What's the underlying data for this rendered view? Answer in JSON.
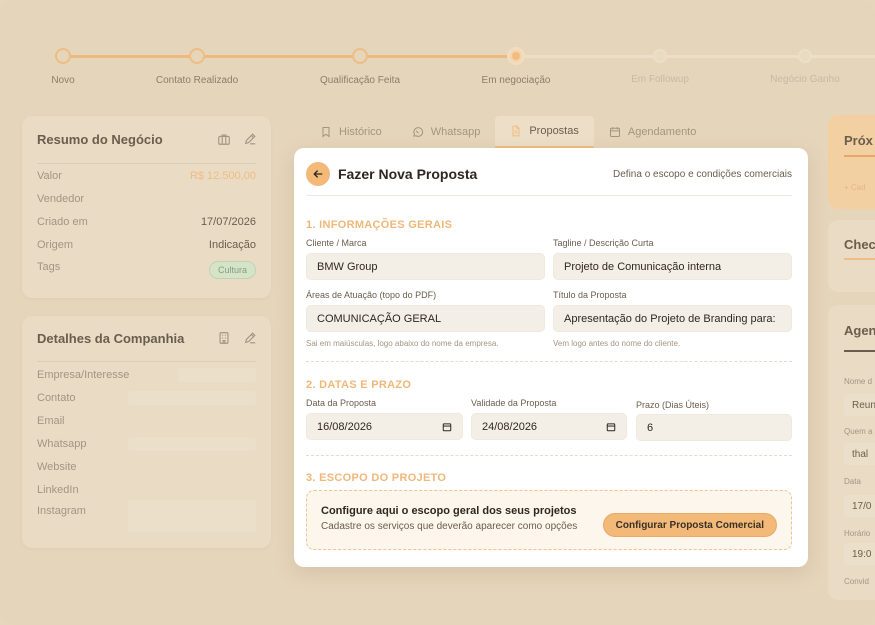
{
  "pipeline": {
    "stages": [
      {
        "label": "Novo"
      },
      {
        "label": "Contato Realizado"
      },
      {
        "label": "Qualificação Feita"
      },
      {
        "label": "Em negociação"
      },
      {
        "label": "Em Followup"
      },
      {
        "label": "Negócio Ganho"
      }
    ]
  },
  "deal_summary": {
    "title": "Resumo do Negócio",
    "rows": [
      {
        "label": "Valor",
        "value": "R$ 12.500,00"
      },
      {
        "label": "Vendedor",
        "value": ""
      },
      {
        "label": "Criado em",
        "value": "17/07/2026"
      },
      {
        "label": "Origem",
        "value": "Indicação"
      },
      {
        "label": "Tags",
        "value": "Cultura"
      }
    ]
  },
  "company_details": {
    "title": "Detalhes da Companhia",
    "rows": [
      {
        "label": "Empresa/Interesse"
      },
      {
        "label": "Contato"
      },
      {
        "label": "Email"
      },
      {
        "label": "Whatsapp"
      },
      {
        "label": "Website"
      },
      {
        "label": "LinkedIn"
      },
      {
        "label": "Instagram"
      }
    ]
  },
  "tabs": [
    {
      "label": "Histórico",
      "icon": "bookmark-icon"
    },
    {
      "label": "Whatsapp",
      "icon": "whatsapp-icon"
    },
    {
      "label": "Propostas",
      "icon": "document-icon"
    },
    {
      "label": "Agendamento",
      "icon": "calendar-icon"
    }
  ],
  "proposal": {
    "title": "Fazer Nova Proposta",
    "subtitle": "Defina o escopo e condições comerciais",
    "section1": {
      "heading": "1. INFORMAÇÕES GERAIS",
      "client_label": "Cliente / Marca",
      "client_value": "BMW Group",
      "tagline_label": "Tagline / Descrição Curta",
      "tagline_value": "Projeto de Comunicação interna",
      "areas_label": "Áreas de Atuação (topo do PDF)",
      "areas_value": "COMUNICAÇÃO GERAL",
      "areas_hint": "Sai em maiúsculas, logo abaixo do nome da empresa.",
      "title_label": "Título da Proposta",
      "title_value": "Apresentação do Projeto de Branding para:",
      "title_hint": "Vem logo antes do nome do cliente."
    },
    "section2": {
      "heading": "2. DATAS E PRAZO",
      "date_label": "Data da Proposta",
      "date_value": "16/08/2026",
      "validity_label": "Validade da Proposta",
      "validity_value": "24/08/2026",
      "deadline_label": "Prazo (Dias Úteis)",
      "deadline_value": "6"
    },
    "section3": {
      "heading": "3. ESCOPO DO PROJETO",
      "box_title": "Configure aqui o escopo geral dos seus projetos",
      "box_desc": "Cadastre os serviços que deverão aparecer como opções",
      "button": "Configurar Proposta Comercial"
    }
  },
  "right_column": {
    "next_title": "Próx",
    "next_add": "+ Cad",
    "check_title": "Chec",
    "agenda_title": "Agen",
    "fields": [
      {
        "label": "Nome d",
        "value": "Reun"
      },
      {
        "label": "Quem a",
        "value": "thal"
      },
      {
        "label": "Data",
        "value": "17/0"
      },
      {
        "label": "Horário",
        "value": "19:0"
      },
      {
        "label": "Convid",
        "value": ""
      }
    ]
  },
  "colors": {
    "accent": "#efbd83",
    "background": "#e5d5bb",
    "card": "#e9dbc4",
    "modal": "#ffffff"
  }
}
